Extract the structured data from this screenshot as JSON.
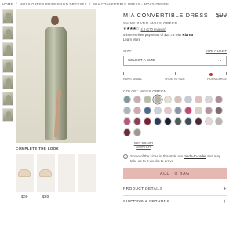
{
  "breadcrumb": [
    "Home",
    "/",
    "Moss Green Bridesmaid Dresses",
    "/",
    "Mia Convertible Dress - Moss Green"
  ],
  "thumbnails": 7,
  "complete_look": {
    "title": "Complete the look",
    "items": [
      {
        "price": "$29",
        "color": "#e9d9c4"
      },
      {
        "price": "$39",
        "color": "#e9d9c4"
      },
      {
        "price": "",
        "color": "#f0ede7"
      },
      {
        "price": "",
        "color": "#f0ede7"
      }
    ]
  },
  "product": {
    "title": "Mia Convertible Dress",
    "price": "$99",
    "subtitle": "Shiny Satin Moss Green",
    "stars": "★★★★☆",
    "rating_text": "4.2 (170 reviews)",
    "klarna_text_prefix": "4 interest-free payments of $24.75 with ",
    "klarna_brand": "Klarna",
    "learn_more": "Learn More"
  },
  "size": {
    "label": "Size:",
    "chart_link": "Size chart",
    "placeholder": "Select a size",
    "chevron": "⌄"
  },
  "fit": {
    "labels": [
      "Runs small",
      "True to size",
      "Runs large"
    ],
    "value": 0.85
  },
  "color": {
    "label": "Color: Moss Green",
    "swatches": [
      "#7d9a9a",
      "#c8adb2",
      "#b7bfa6",
      "#b6b2a2",
      "#e8e0d0",
      "#d8c0b8",
      "#c3cbd6",
      "#e2c0b9",
      "#d7d7d7",
      "#b48a94",
      "#a7b6c4",
      "#d4a6b2",
      "#4d6a8f",
      "#c6d3dd",
      "#e4c6cb",
      "#8c95a7",
      "#bf4a6e",
      "#d7d2c8",
      "#b6939b",
      "#7e6a74",
      "#b35a76",
      "#8a4053",
      "#7b2134",
      "#2d3c5c",
      "#1b2030",
      "#4f5b57",
      "#3d4e58",
      "#4a2a3a",
      "#ead6d8",
      "#b8b5b0",
      "#6a2b35",
      "#9a9a92"
    ],
    "selected_index": 3
  },
  "get_swatch": "Get color swatch",
  "note": {
    "prefix": "Some of the sizes in this style are ",
    "link": "made-to-order",
    "suffix": " and may take up to 8 weeks to arrive"
  },
  "add_to_bag": "Add to bag",
  "accordion": [
    {
      "label": "Product details",
      "icon": "+"
    },
    {
      "label": "Shipping & returns",
      "icon": "+"
    }
  ]
}
